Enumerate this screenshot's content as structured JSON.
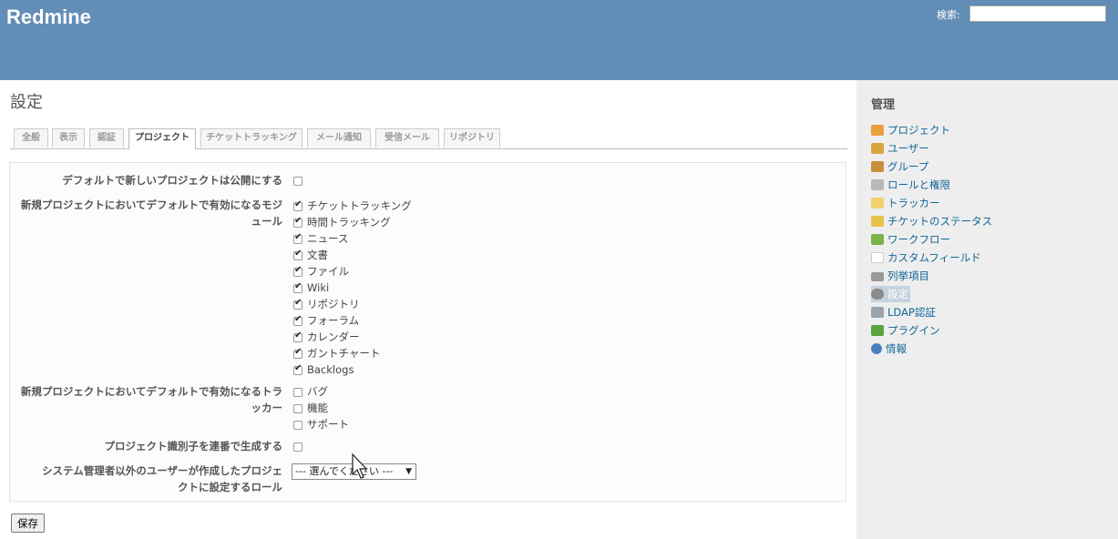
{
  "header": {
    "app_title": "Redmine",
    "search_label": "検索:",
    "search_value": ""
  },
  "page": {
    "title": "設定"
  },
  "tabs": [
    "全般",
    "表示",
    "認証",
    "プロジェクト",
    "チケットトラッキング",
    "メール通知",
    "受信メール",
    "リポジトリ"
  ],
  "settings": {
    "public_default_label": "デフォルトで新しいプロジェクトは公開にする",
    "modules_label_line1": "新規プロジェクトにおいてデフォルトで有効になるモジ",
    "modules_label_line2": "ュール",
    "modules": [
      "チケットトラッキング",
      "時間トラッキング",
      "ニュース",
      "文書",
      "ファイル",
      "Wiki",
      "リポジトリ",
      "フォーラム",
      "カレンダー",
      "ガントチャート",
      "Backlogs"
    ],
    "trackers_label_line1": "新規プロジェクトにおいてデフォルトで有効になるトラ",
    "trackers_label_line2": "ッカー",
    "trackers": [
      "バグ",
      "機能",
      "サポート"
    ],
    "sequential_label": "プロジェクト識別子を連番で生成する",
    "role_label_line1": "システム管理者以外のユーザーが作成したプロジェ",
    "role_label_line2": "クトに設定するロール",
    "role_select_value": "--- 選んでください ---"
  },
  "save_label": "保存",
  "sidebar": {
    "title": "管理",
    "items": [
      "プロジェクト",
      "ユーザー",
      "グループ",
      "ロールと権限",
      "トラッカー",
      "チケットのステータス",
      "ワークフロー",
      "カスタムフィールド",
      "列挙項目",
      "設定",
      "LDAP認証",
      "プラグイン",
      "情報"
    ]
  },
  "colors": {
    "header": "#628db6",
    "link": "#169",
    "sidebar_bg": "#eee"
  }
}
